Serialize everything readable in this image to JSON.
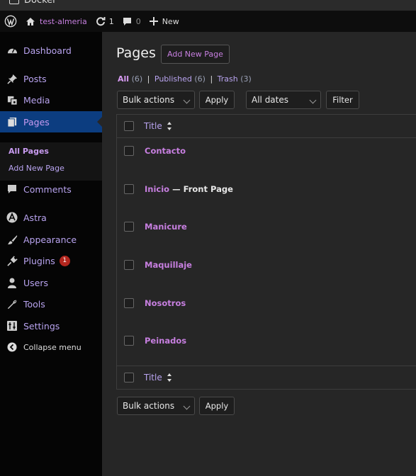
{
  "window": {
    "title": "Docker"
  },
  "adminbar": {
    "site_name": "test-almeria",
    "updates_count": "1",
    "comments_count": "0",
    "new_label": "New"
  },
  "sidebar": {
    "items": [
      {
        "label": "Dashboard",
        "icon": "dashboard-icon"
      },
      {
        "label": "Posts",
        "icon": "pin-icon"
      },
      {
        "label": "Media",
        "icon": "media-icon"
      },
      {
        "label": "Pages",
        "icon": "pages-icon"
      },
      {
        "label": "Comments",
        "icon": "comment-icon"
      },
      {
        "label": "Astra",
        "icon": "astra-icon"
      },
      {
        "label": "Appearance",
        "icon": "brush-icon"
      },
      {
        "label": "Plugins",
        "icon": "plug-icon",
        "badge": "1"
      },
      {
        "label": "Users",
        "icon": "user-icon"
      },
      {
        "label": "Tools",
        "icon": "wrench-icon"
      },
      {
        "label": "Settings",
        "icon": "settings-icon"
      }
    ],
    "submenu": {
      "all_pages": "All Pages",
      "add_new_page": "Add New Page"
    },
    "collapse_label": "Collapse menu"
  },
  "main": {
    "title": "Pages",
    "add_new_label": "Add New Page",
    "views": {
      "all": "All",
      "all_count": "(6)",
      "published": "Published",
      "published_count": "(6)",
      "trash": "Trash",
      "trash_count": "(3)"
    },
    "bulk_actions": "Bulk actions",
    "apply": "Apply",
    "dates": "All dates",
    "filter": "Filter",
    "column_title": "Title",
    "rows": [
      {
        "title": "Contacto",
        "state": ""
      },
      {
        "title": "Inicio",
        "state": " — Front Page"
      },
      {
        "title": "Manicure",
        "state": ""
      },
      {
        "title": "Maquillaje",
        "state": ""
      },
      {
        "title": "Nosotros",
        "state": ""
      },
      {
        "title": "Peinados",
        "state": ""
      }
    ]
  },
  "colors": {
    "accent": "#c77fe0",
    "menu_active": "#0c3d80",
    "badge": "#b3261e"
  }
}
